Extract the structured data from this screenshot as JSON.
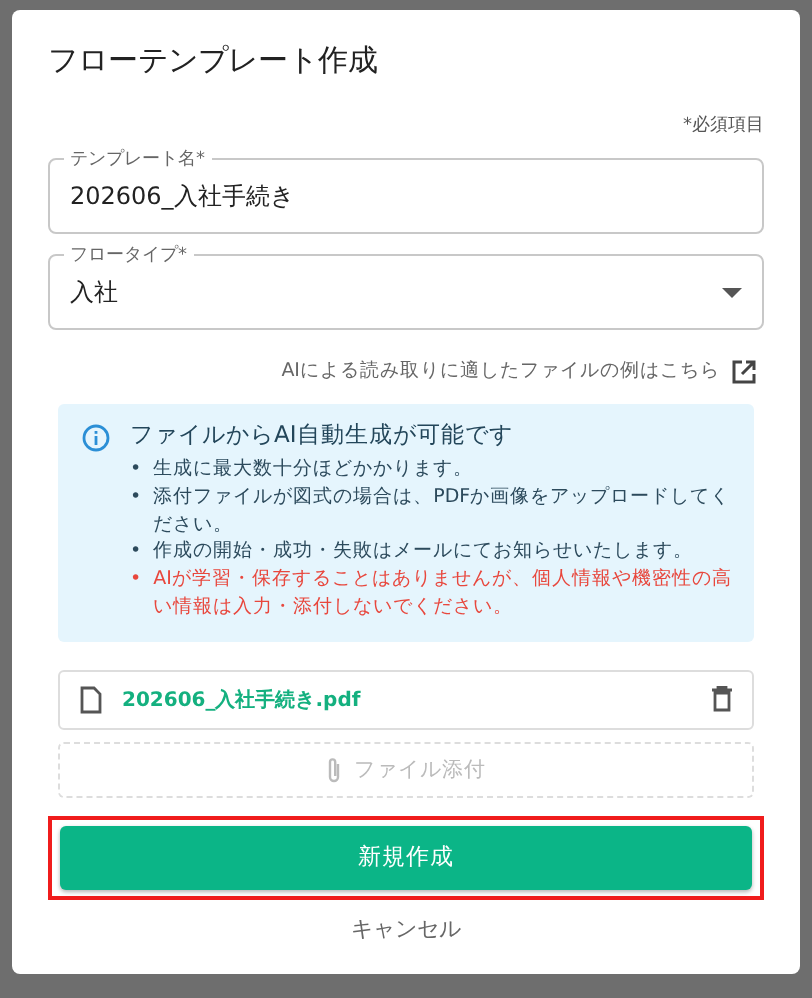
{
  "dialog": {
    "title": "フローテンプレート作成",
    "required_note": "*必須項目"
  },
  "template_name": {
    "label": "テンプレート名*",
    "value": "202606_入社手続き"
  },
  "flow_type": {
    "label": "フロータイプ*",
    "value": "入社"
  },
  "example_link": "AIによる読み取りに適したファイルの例はこちら",
  "info": {
    "title": "ファイルからAI自動生成が可能です",
    "items": [
      {
        "bullet": "•",
        "text": "生成に最大数十分ほどかかります。",
        "warning": false
      },
      {
        "bullet": "•",
        "text": "添付ファイルが図式の場合は、PDFか画像をアップロードしてください。",
        "warning": false
      },
      {
        "bullet": "•",
        "text": "作成の開始・成功・失敗はメールにてお知らせいたします。",
        "warning": false
      },
      {
        "bullet": "•",
        "text": "AIが学習・保存することはありませんが、個人情報や機密性の高い情報は入力・添付しないでください。",
        "warning": true
      }
    ]
  },
  "attached_file": "202606_入社手続き.pdf",
  "attach_button": "ファイル添付",
  "create_button": {
    "label": "新規作成",
    "highlighted": true
  },
  "cancel_button": "キャンセル"
}
